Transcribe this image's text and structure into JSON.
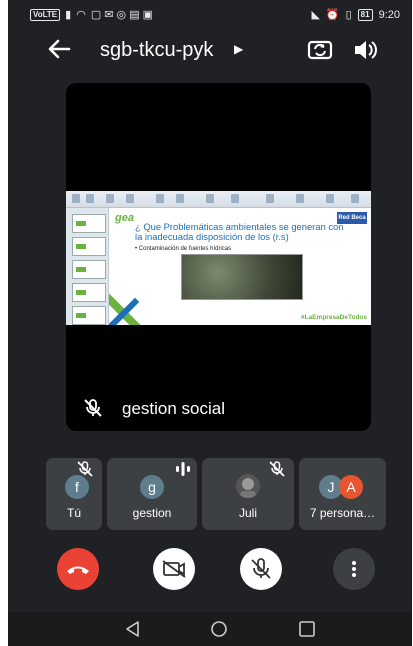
{
  "status_bar": {
    "volte_label": "VoLTE",
    "battery_percent": "81",
    "time": "9:20"
  },
  "header": {
    "meeting_code": "sgb-tkcu-pyk"
  },
  "main_tile": {
    "participant_name": "gestion social",
    "slide": {
      "logo_text": "gea",
      "corner_logo_text": "Red Beca",
      "question": "¿ Que Problemáticas ambientales se generan con la inadecuada disposición de los (r.s)",
      "bullet": "Contaminación de fuentes hídricas",
      "hashtag": "#LaEmpresaDeTodos"
    }
  },
  "participants": [
    {
      "avatar_letter": "f",
      "label": "Tú",
      "muted": true,
      "avatar_color": "#607d8b"
    },
    {
      "avatar_letter": "g",
      "label": "gestion",
      "muted": false,
      "speaking": true,
      "avatar_color": "#607d8b"
    },
    {
      "avatar_letter": "",
      "label": "Juli",
      "muted": true,
      "avatar_color": "#555555"
    },
    {
      "avatar_letter": "J",
      "avatar_letter_2": "A",
      "label": "7 persona…",
      "muted": false,
      "avatar_color": "#607d8b",
      "avatar_color_2": "#e8552f"
    }
  ],
  "controls": {
    "end_call_color": "#ea4335"
  }
}
